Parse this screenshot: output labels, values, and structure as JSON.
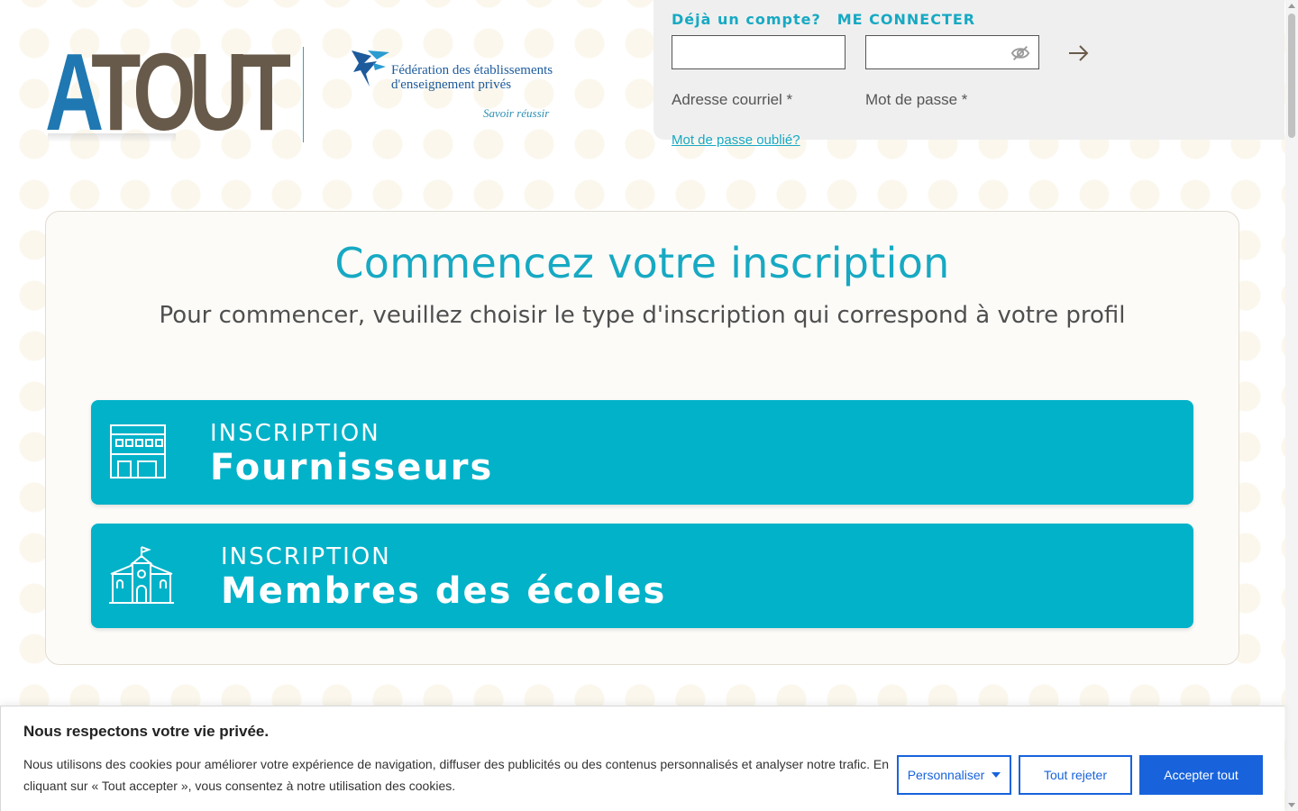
{
  "branding": {
    "logo_atout_a": "A",
    "logo_atout_rest": "TOUT",
    "federation_line1": "Fédération des établissements",
    "federation_line2": "d'enseignement privés",
    "federation_tagline": "Savoir réussir",
    "atout_colors": {
      "a": "#1f78b1",
      "rest": "#675a4a"
    }
  },
  "login": {
    "prompt": "Déjà un compte?",
    "connect_label": "ME CONNECTER",
    "email_label": "Adresse courriel *",
    "password_label": "Mot de passe *",
    "email_value": "",
    "password_value": "",
    "forgot_link": "Mot de passe oublié?",
    "icons": {
      "password_toggle": "eye-off-icon",
      "submit": "arrow-right-icon"
    }
  },
  "main": {
    "title": "Commencez votre inscription",
    "subtitle": "Pour commencer, veuillez choisir le type d'inscription qui correspond à votre profil",
    "options": [
      {
        "small": "INSCRIPTION",
        "big": "Fournisseurs",
        "icon": "building-icon"
      },
      {
        "small": "INSCRIPTION",
        "big": "Membres des écoles",
        "icon": "school-icon"
      }
    ]
  },
  "cookie_banner": {
    "title": "Nous respectons votre vie privée.",
    "text": "Nous utilisons des cookies pour améliorer votre expérience de navigation, diffuser des publicités ou des contenus personnalisés et analyser notre trafic. En cliquant sur « Tout accepter », vous consentez à notre utilisation des cookies.",
    "customize_label": "Personnaliser",
    "reject_label": "Tout rejeter",
    "accept_label": "Accepter tout"
  },
  "colors": {
    "accent": "#17a9c3",
    "button_bg": "#02b2c9",
    "cookie_primary": "#1863dc",
    "login_panel_bg": "#efefef"
  }
}
